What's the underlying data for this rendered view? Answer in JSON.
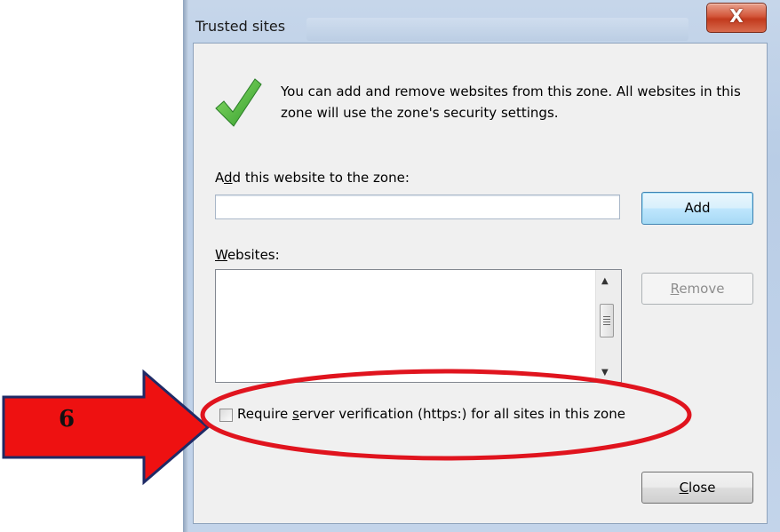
{
  "window": {
    "title": "Trusted sites",
    "close_glyph": "X"
  },
  "info": {
    "icon": "green-check-icon",
    "text": "You can add and remove websites from this zone. All websites in this zone will use the zone's security settings."
  },
  "add_section": {
    "label_pre": "A",
    "label_u": "d",
    "label_post": "d this website to the zone:",
    "input_value": "",
    "add_button": "Add"
  },
  "websites": {
    "label_u": "W",
    "label_post": "ebsites:",
    "items": [],
    "remove_pre": "",
    "remove_u": "R",
    "remove_post": "emove"
  },
  "https_option": {
    "checked": false,
    "label_pre": "Require ",
    "label_u": "s",
    "label_post": "erver verification (https:) for all sites in this zone"
  },
  "footer": {
    "close_u": "C",
    "close_post": "lose"
  },
  "annotation": {
    "step_number": "6",
    "arrow_color": "#ee1111",
    "ellipse_color": "#e0141e"
  }
}
